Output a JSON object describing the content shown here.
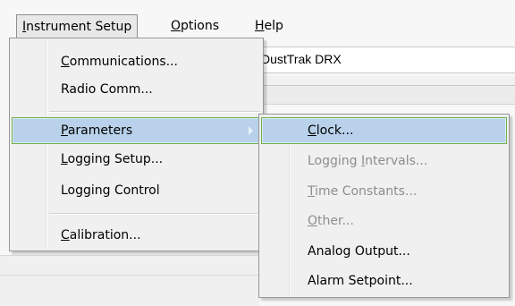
{
  "menubar": {
    "items": [
      {
        "label": "Instrument Setup",
        "underline": "I"
      },
      {
        "label": "Options",
        "underline": "O"
      },
      {
        "label": "Help",
        "underline": "H"
      }
    ]
  },
  "background": {
    "device_name": "DustTrak DRX"
  },
  "instrument_menu": {
    "items": [
      {
        "label": "Communications...",
        "underline": "C"
      },
      {
        "label": "Radio Comm...",
        "underline": ""
      },
      {
        "label": "Parameters",
        "underline": "P",
        "has_submenu": true,
        "highlighted": true
      },
      {
        "label": "Logging Setup...",
        "underline": "L"
      },
      {
        "label": "Logging Control",
        "underline": ""
      },
      {
        "label": "Calibration...",
        "underline": "C"
      }
    ]
  },
  "parameters_submenu": {
    "items": [
      {
        "label": "Clock...",
        "underline": "C",
        "enabled": true,
        "highlighted": true
      },
      {
        "label": "Logging Intervals...",
        "underline": "I",
        "enabled": false
      },
      {
        "label": "Time Constants...",
        "underline": "T",
        "enabled": false
      },
      {
        "label": "Other...",
        "underline": "O",
        "enabled": false
      },
      {
        "label": "Analog Output...",
        "underline": "",
        "enabled": true
      },
      {
        "label": "Alarm Setpoint...",
        "underline": "",
        "enabled": true
      }
    ]
  },
  "colors": {
    "highlight_fill": "#b9d1ea",
    "highlight_border": "#6fb04d",
    "disabled_text": "#8d8d8d"
  }
}
